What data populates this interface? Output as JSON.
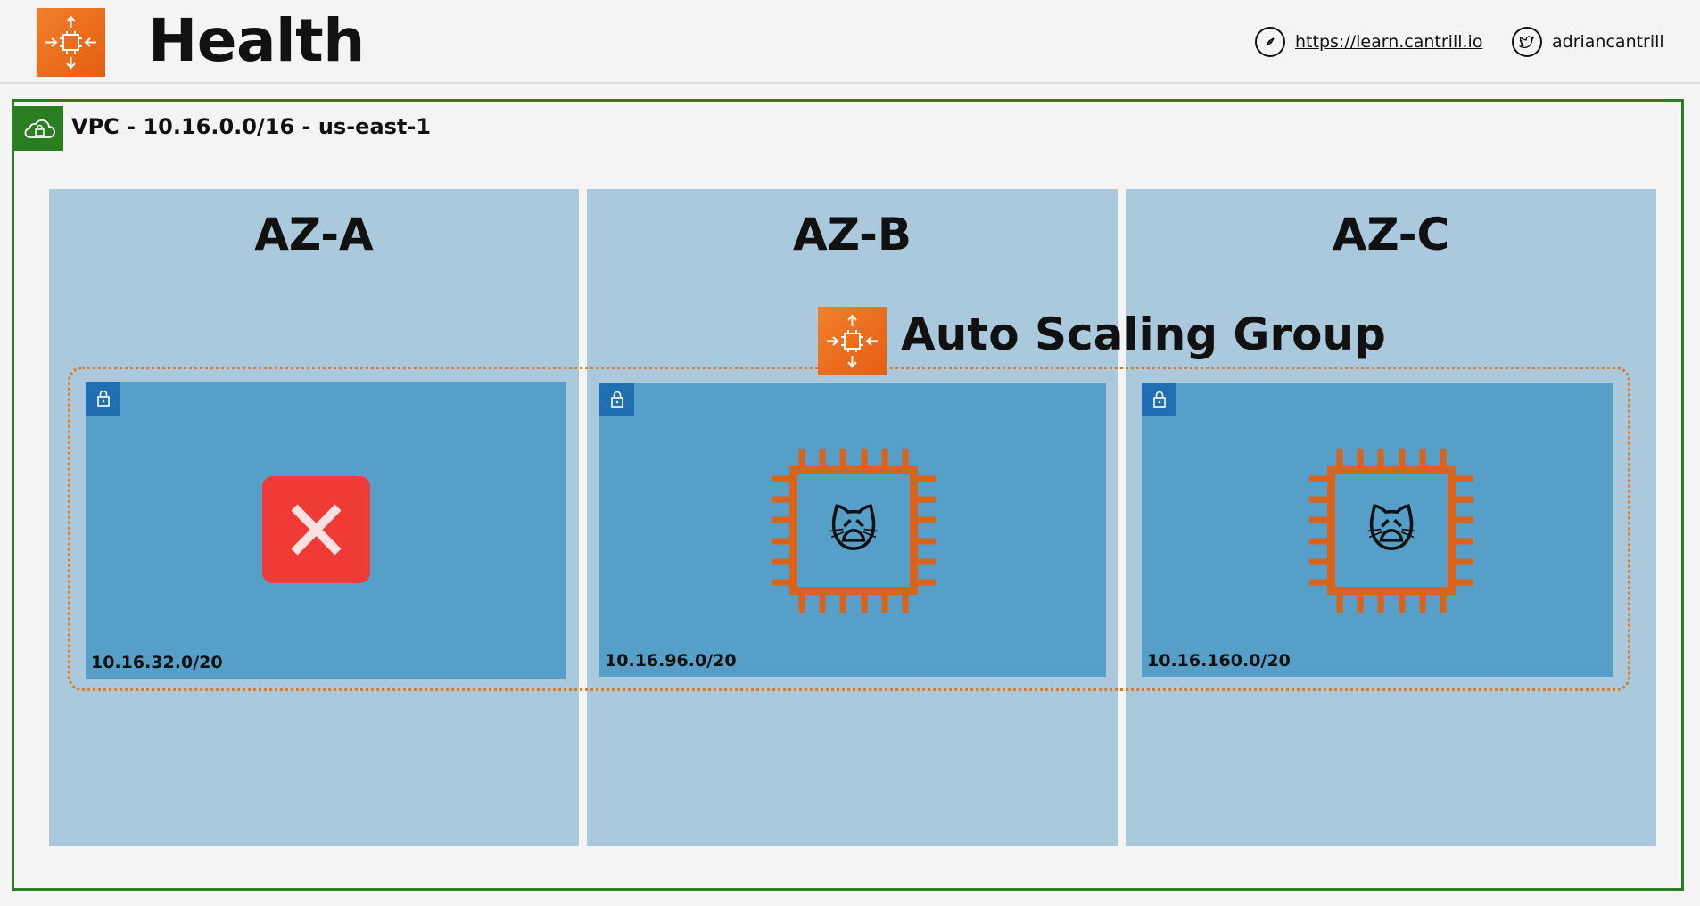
{
  "header": {
    "title": "Health",
    "logo_icon": "auto-scaling-icon",
    "link_icon": "compass-icon",
    "link_text": "https://learn.cantrill.io",
    "handle_icon": "twitter-icon",
    "handle_text": "adriancantrill"
  },
  "vpc": {
    "icon": "vpc-cloud-lock-icon",
    "label": "VPC - 10.16.0.0/16 - us-east-1",
    "border_color": "#2b7d22"
  },
  "azs": [
    {
      "label": "AZ-A"
    },
    {
      "label": "AZ-B"
    },
    {
      "label": "AZ-C"
    }
  ],
  "asg": {
    "label": "Auto Scaling Group",
    "icon": "auto-scaling-icon",
    "border_color": "#e07a1f"
  },
  "subnets": [
    {
      "cidr": "10.16.32.0/20",
      "status": "failed",
      "icon": "error-x-icon"
    },
    {
      "cidr": "10.16.96.0/20",
      "status": "healthy",
      "icon": "ec2-instance-icon",
      "emoji": "🙀"
    },
    {
      "cidr": "10.16.160.0/20",
      "status": "healthy",
      "icon": "ec2-instance-icon",
      "emoji": "🙀"
    }
  ],
  "colors": {
    "az_background": "#aac9dc",
    "subnet_background": "#569fc8",
    "subnet_lock": "#1f6fb2",
    "instance": "#d9631b",
    "error": "#ef3a35"
  }
}
